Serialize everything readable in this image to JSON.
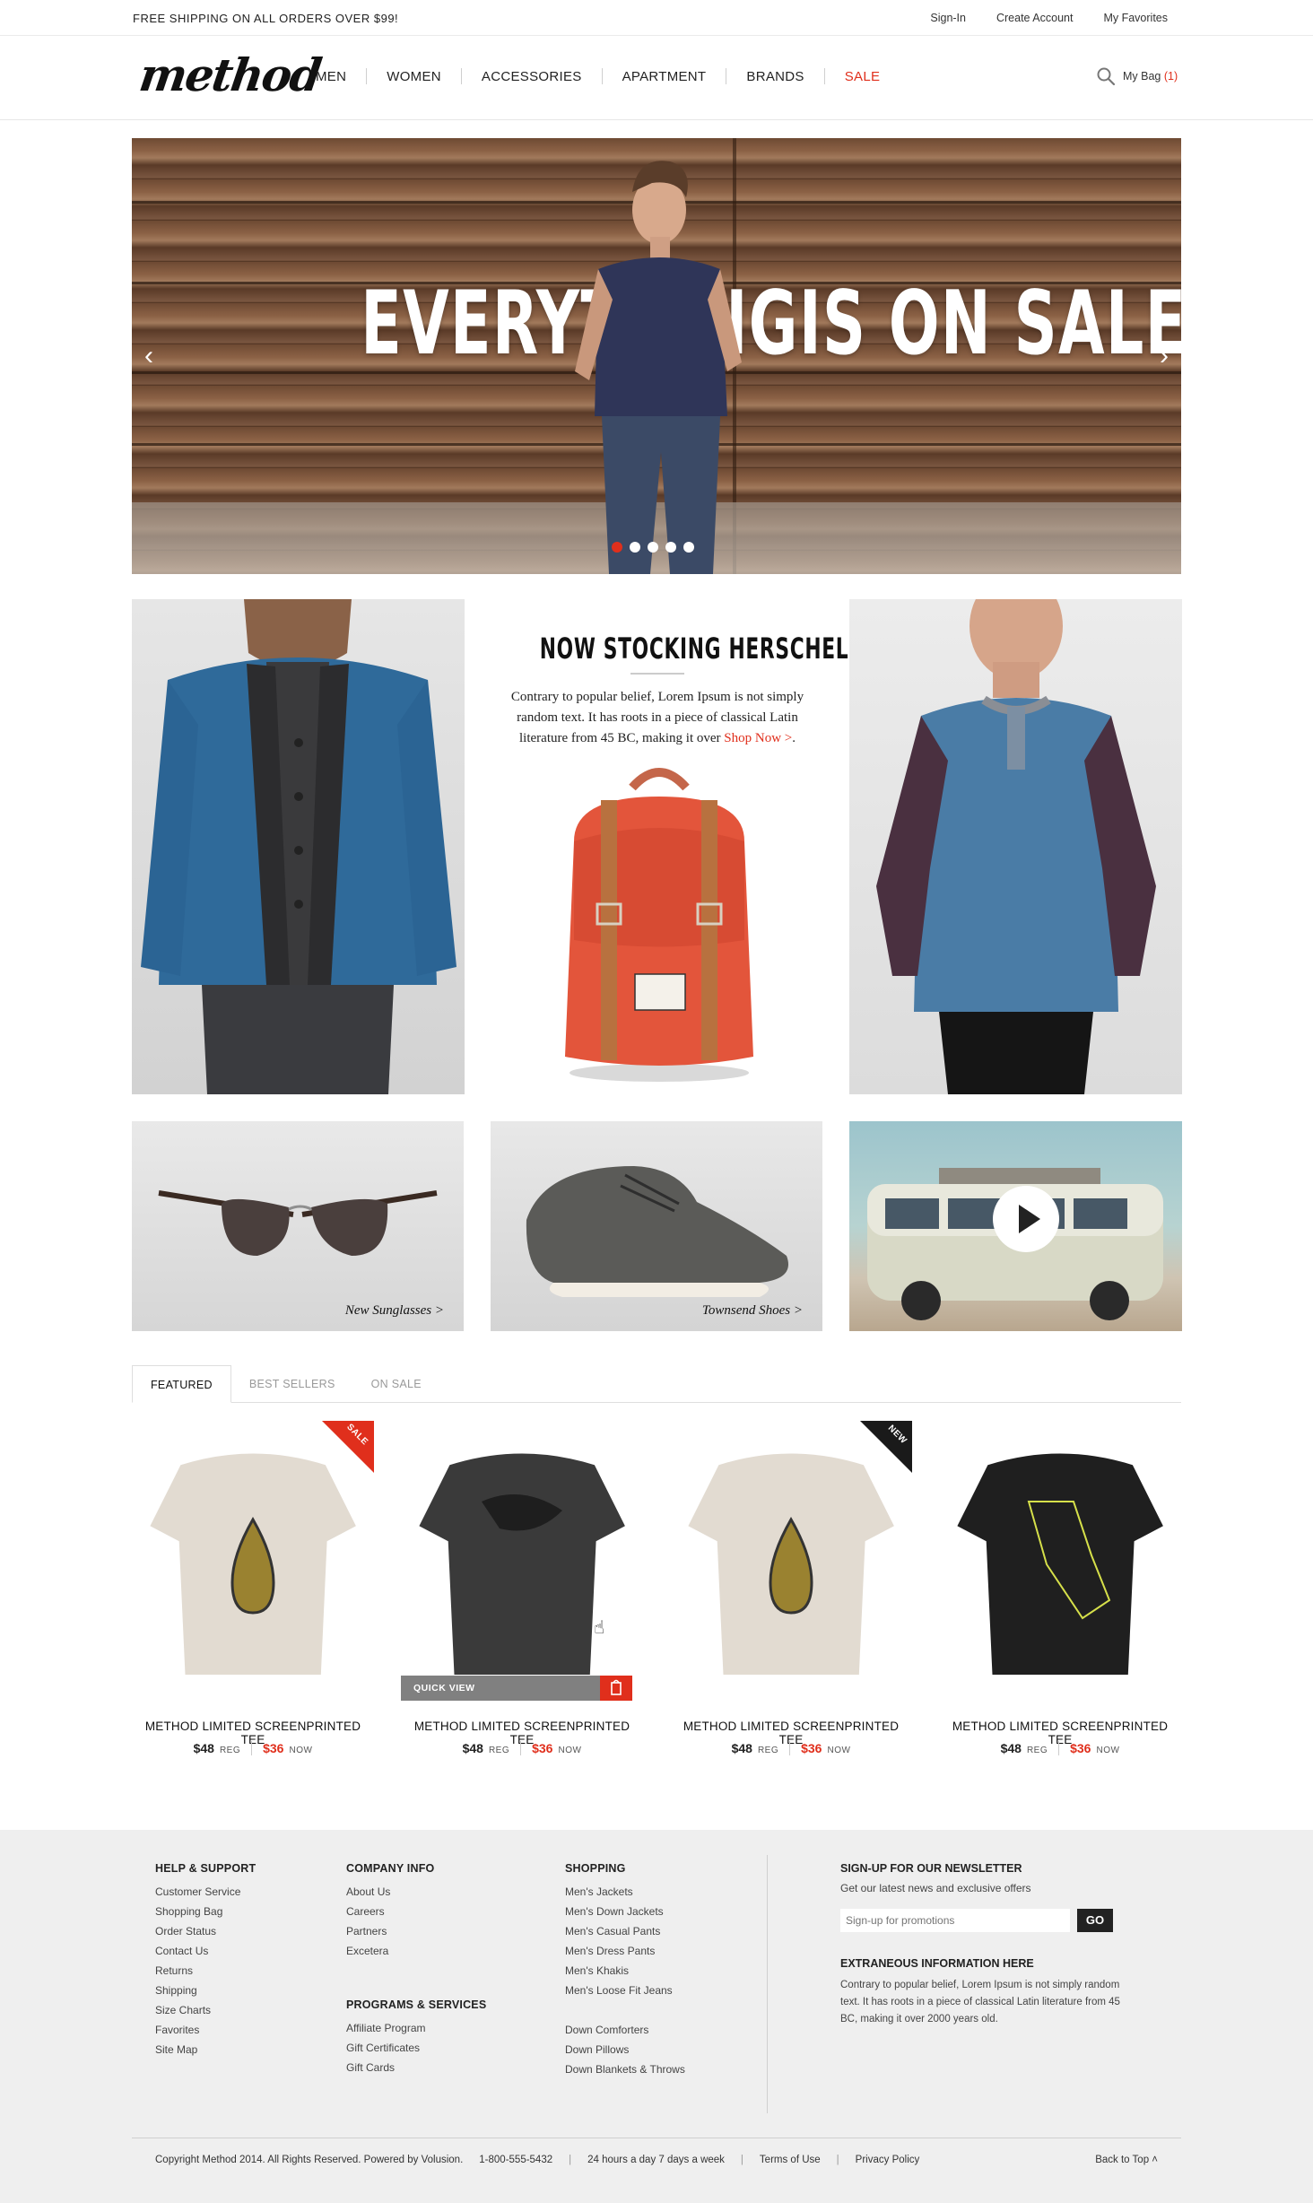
{
  "topbar": {
    "promo": "FREE SHIPPING ON ALL ORDERS OVER $99!",
    "links": [
      "Sign-In",
      "Create Account",
      "My Favorites"
    ]
  },
  "header": {
    "logo": "method",
    "nav": [
      "MEN",
      "WOMEN",
      "ACCESSORIES",
      "APARTMENT",
      "BRANDS",
      "SALE"
    ],
    "bag_label": "My Bag",
    "bag_count": "(1)"
  },
  "hero": {
    "headline_left": "EVERYTHING",
    "headline_right": "IS ON SALE.",
    "slide_count": 5,
    "active_slide": 1
  },
  "feature": {
    "title": "NOW STOCKING HERSCHEL BAGS.",
    "body": "Contrary to popular belief, Lorem Ipsum is not simply random text. It has roots in a piece of classical Latin literature from 45 BC, making it over",
    "link": "Shop Now >",
    "tail": "."
  },
  "tiles": {
    "sunglasses": "New Sunglasses >",
    "shoes": "Townsend Shoes >"
  },
  "tabs": [
    "FEATURED",
    "BEST SELLERS",
    "ON SALE"
  ],
  "products": [
    {
      "title": "METHOD LIMITED SCREENPRINTED TEE",
      "reg_price": "$48",
      "reg_label": "REG",
      "now_price": "$36",
      "now_label": "NOW",
      "ribbon": "SALE"
    },
    {
      "title": "METHOD LIMITED SCREENPRINTED TEE",
      "reg_price": "$48",
      "reg_label": "REG",
      "now_price": "$36",
      "now_label": "NOW",
      "quick_view": "QUICK VIEW"
    },
    {
      "title": "METHOD LIMITED SCREENPRINTED TEE",
      "reg_price": "$48",
      "reg_label": "REG",
      "now_price": "$36",
      "now_label": "NOW",
      "ribbon": "NEW"
    },
    {
      "title": "METHOD LIMITED SCREENPRINTED TEE",
      "reg_price": "$48",
      "reg_label": "REG",
      "now_price": "$36",
      "now_label": "NOW"
    }
  ],
  "footer": {
    "help": {
      "title": "HELP & SUPPORT",
      "links": [
        "Customer Service",
        "Shopping Bag",
        "Order Status",
        "Contact Us",
        "Returns",
        "Shipping",
        "Size Charts",
        "Favorites",
        "Site Map"
      ]
    },
    "company": {
      "title": "COMPANY INFO",
      "links": [
        "About Us",
        "Careers",
        "Partners",
        "Excetera"
      ]
    },
    "programs": {
      "title": "PROGRAMS & SERVICES",
      "links": [
        "Affiliate Program",
        "Gift Certificates",
        "Gift Cards"
      ]
    },
    "shopping": {
      "title": "SHOPPING",
      "links": [
        "Men's Jackets",
        "Men's Down Jackets",
        "Men's Casual Pants",
        "Men's Dress Pants",
        "Men's Khakis",
        "Men's Loose Fit Jeans"
      ],
      "links2": [
        "Down Comforters",
        "Down Pillows",
        "Down Blankets & Throws"
      ]
    },
    "newsletter": {
      "title": "SIGN-UP FOR OUR NEWSLETTER",
      "sub": "Get our latest news and exclusive offers",
      "placeholder": "Sign-up for promotions",
      "go": "GO"
    },
    "extra": {
      "title": "EXTRANEOUS INFORMATION HERE",
      "text": "Contrary to popular belief, Lorem Ipsum is not simply random text. It has roots in a piece of classical Latin literature from 45 BC, making it over 2000 years old."
    },
    "bottom": {
      "copyright": "Copyright Method 2014. All Rights Reserved. Powered by Volusion.",
      "phone": "1-800-555-5432",
      "hours": "24 hours a day 7 days a week",
      "terms": "Terms of Use",
      "privacy": "Privacy Policy",
      "back_to_top": "Back to Top ˄"
    }
  },
  "colors": {
    "accent": "#e02f1c",
    "dark": "#111111",
    "footer_bg": "#efefef"
  }
}
